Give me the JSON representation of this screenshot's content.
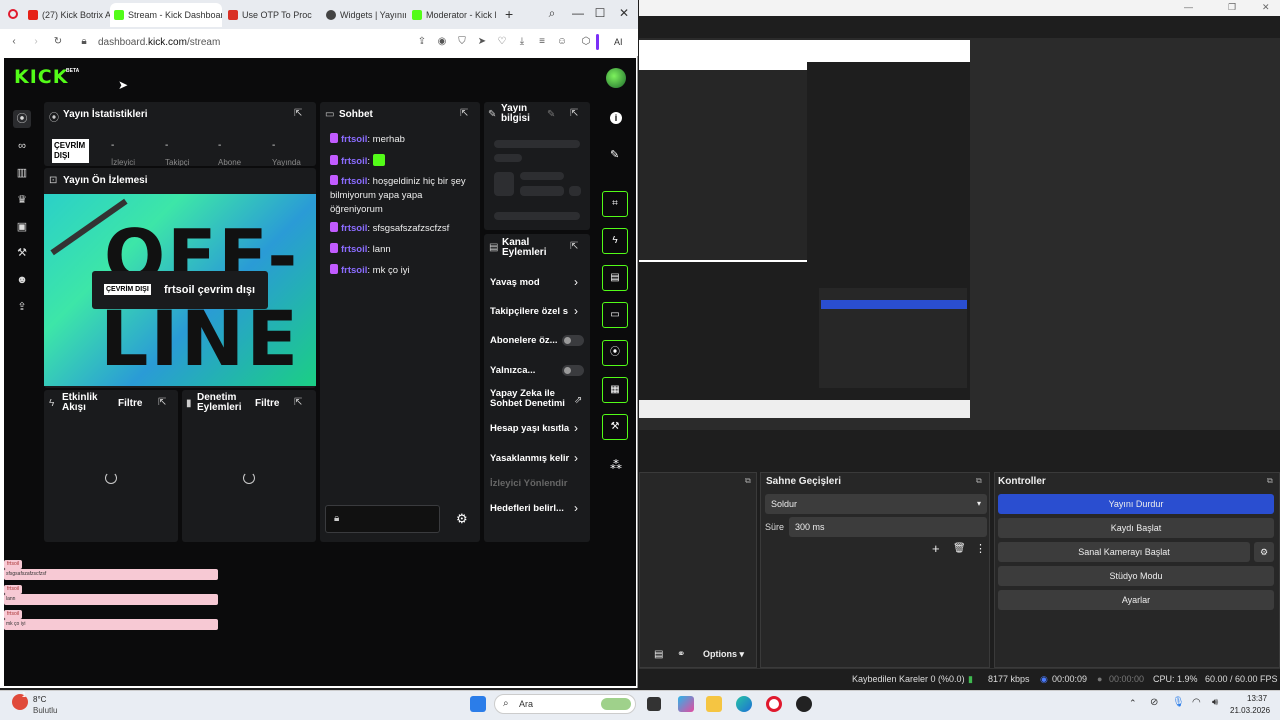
{
  "browser": {
    "tabs": [
      {
        "label": "(27) Kick Botrix Ay"
      },
      {
        "label": "Stream - Kick Dashboard"
      },
      {
        "label": "Use OTP To Proce"
      },
      {
        "label": "Widgets | Yayınını"
      },
      {
        "label": "Moderator - Kick D"
      }
    ],
    "new_tab": "+",
    "url_prefix": "dashboard.",
    "url_domain": "kick.com",
    "url_path": "/stream",
    "ai_label": "AI"
  },
  "kick": {
    "logo": "KICK",
    "beta": "BETA",
    "stats": {
      "title": "Yayın İstatistikleri",
      "status": "ÇEVRİM DIŞI",
      "values": [
        "-",
        "-",
        "-",
        "-"
      ],
      "labels": [
        "İzleyici",
        "Takipçi",
        "Abone",
        "Yayında"
      ]
    },
    "preview": {
      "title": "Yayın Ön İzlemesi",
      "badge": "ÇEVRİM DIŞI",
      "message": "frtsoil çevrim dışı",
      "big1": "OFF-",
      "big2": "LINE"
    },
    "activity": {
      "title": "Etkinlik Akışı",
      "filter": "Filtre"
    },
    "modlog": {
      "title": "Denetim Eylemleri",
      "filter": "Filtre"
    },
    "chat": {
      "title": "Sohbet",
      "messages": [
        {
          "user": "frtsoil",
          "text": "merhab"
        },
        {
          "user": "frtsoil",
          "text": ""
        },
        {
          "user": "frtsoil",
          "text": "hoşgeldiniz hiç bir şey bilmiyorum yapa yapa öğreniyorum"
        },
        {
          "user": "frtsoil",
          "text": "sfsgsafszafzscfzsf"
        },
        {
          "user": "frtsoil",
          "text": "lann"
        },
        {
          "user": "frtsoil",
          "text": "mk ço iyi"
        }
      ]
    },
    "info": {
      "title": "Yayın bilgisi"
    },
    "actions": {
      "title": "Kanal Eylemleri",
      "items": [
        "Yavaş mod",
        "Takipçilere özel s",
        "Abonelere öz...",
        "Yalnızca...",
        "Yapay Zeka ile Sohbet Denetimi",
        "Hesap yaşı kısıtla",
        "Yasaklanmış kelir",
        "İzleyici Yönlendir",
        "Hedefleri belirl..."
      ]
    },
    "overlay_chat": [
      {
        "user": "frtsoil",
        "text": "sfsgsafszafzscfzsf"
      },
      {
        "user": "frtsoil",
        "text": "lann"
      },
      {
        "user": "frtsoil",
        "text": "mk ço iyi"
      }
    ]
  },
  "obs": {
    "transitions": {
      "title": "Sahne Geçişleri",
      "selected": "Soldur",
      "duration_label": "Süre",
      "duration_value": "300 ms"
    },
    "controls": {
      "title": "Kontroller",
      "buttons": [
        "Yayını Durdur",
        "Kaydı Başlat",
        "Sanal Kamerayı Başlat",
        "Stüdyo Modu",
        "Ayarlar"
      ]
    },
    "options_label": "Options",
    "status": {
      "dropped": "Kaybedilen Kareler 0 (%0.0)",
      "bitrate": "8177 kbps",
      "stream_time": "00:00:09",
      "rec_time": "00:00:00",
      "cpu": "CPU: 1.9%",
      "fps": "60.00 / 60.00 FPS"
    },
    "accent": "#2a4ed0"
  },
  "taskbar": {
    "weather_temp": "8°C",
    "weather_desc": "Bulutlu",
    "search": "Ara",
    "time": "13:37",
    "date": "21.03.2026",
    "weather_badge": "1"
  },
  "colors": {
    "kick_green": "#53fc18",
    "chat_user": "#8b6cff"
  }
}
